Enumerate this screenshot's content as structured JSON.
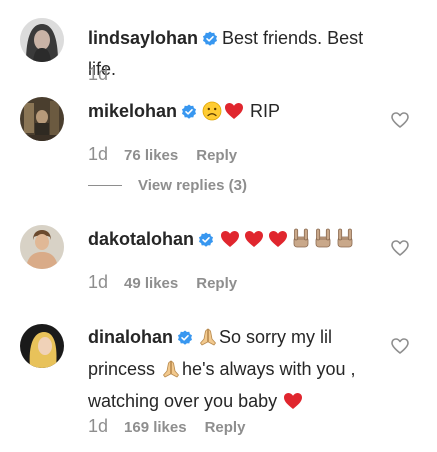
{
  "comments": [
    {
      "username": "lindsaylohan",
      "text": "Best friends. Best life.",
      "time": "1d",
      "likes": "",
      "reply": ""
    },
    {
      "username": "mikelohan",
      "text": "RIP",
      "time": "1d",
      "likes": "76 likes",
      "reply": "Reply",
      "view_replies": "View replies (3)"
    },
    {
      "username": "dakotalohan",
      "text": "",
      "time": "1d",
      "likes": "49 likes",
      "reply": "Reply"
    },
    {
      "username": "dinalohan",
      "text_part1": "So sorry my lil",
      "text_part2": "princess",
      "text_part3": "he's always with you ,",
      "text_part4": "watching over you baby",
      "time": "1d",
      "likes": "169 likes",
      "reply": "Reply"
    }
  ],
  "colors": {
    "primary_text": "#262626",
    "secondary_text": "#8e8e8e",
    "verified_blue": "#3897f0",
    "heart_red": "#e0262e"
  },
  "icons": {
    "verified": "verified-badge-icon",
    "like": "heart-outline-icon",
    "sad_face": "sad-face-emoji",
    "red_heart": "red-heart-emoji",
    "rock_hand": "rock-on-hand-emoji",
    "praying_hands": "praying-hands-emoji"
  }
}
